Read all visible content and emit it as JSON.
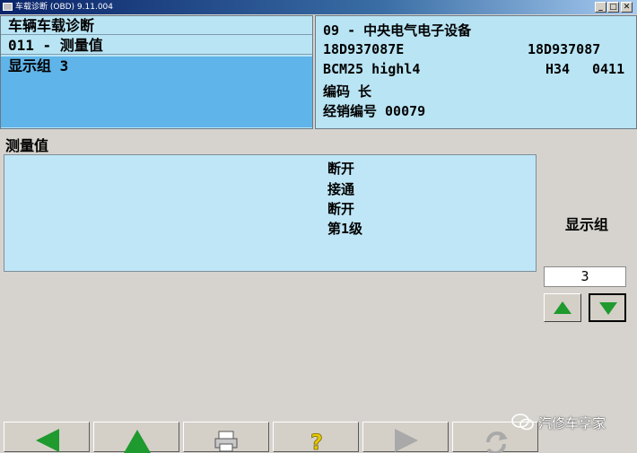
{
  "window": {
    "title": "车载诊断 (OBD)  9.11.004",
    "min_glyph": "_",
    "max_glyph": "□",
    "close_glyph": "✕"
  },
  "left_panel": {
    "items": [
      {
        "label": "车辆车载诊断"
      },
      {
        "label": "011 - 测量值"
      },
      {
        "label": "显示组 3"
      }
    ]
  },
  "right_panel": {
    "module": "09 - 中央电气电子设备",
    "part_number": "18D937087E",
    "part_number_right": "18D937087",
    "component": "BCM25 highl4",
    "hw_version": "H34",
    "sw_version": "0411",
    "coding": "编码 长",
    "dealer": "经销编号 00079"
  },
  "measurements": {
    "title": "测量值",
    "values": [
      "断开",
      "接通",
      "断开",
      "第1级"
    ]
  },
  "display_group": {
    "label": "显示组",
    "value": "3"
  },
  "toolbar": {
    "buttons": [
      {
        "name": "back",
        "icon": "arrow-left-icon"
      },
      {
        "name": "up",
        "icon": "arrow-up-icon"
      },
      {
        "name": "print",
        "icon": "printer-icon"
      },
      {
        "name": "help",
        "icon": "help-icon"
      },
      {
        "name": "forward",
        "icon": "arrow-right-icon"
      },
      {
        "name": "refresh",
        "icon": "refresh-icon"
      }
    ]
  },
  "watermark": {
    "text": "汽修车享家"
  },
  "colors": {
    "panel_bg": "#b9e4f3",
    "selected_bg": "#5fb4e9",
    "arrow_green": "#1e9a2e"
  }
}
